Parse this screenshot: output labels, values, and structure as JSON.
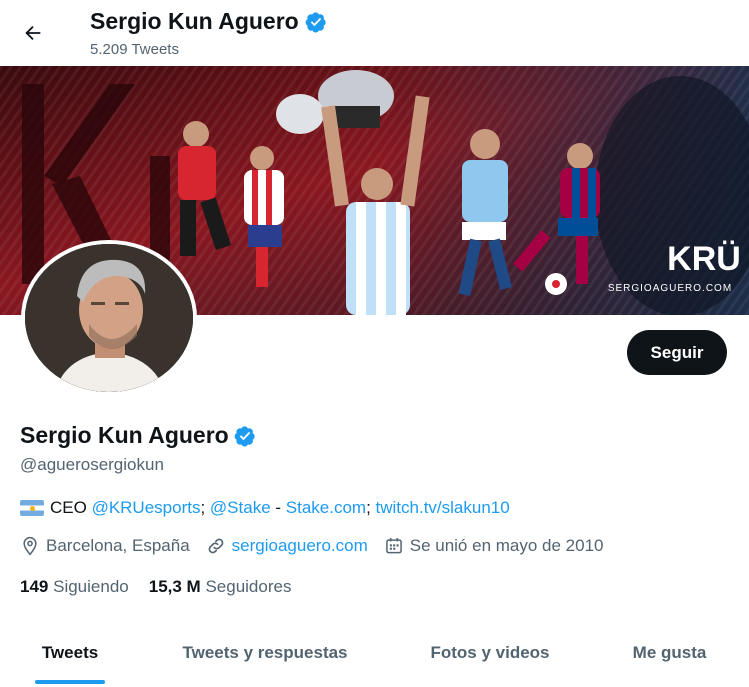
{
  "header": {
    "name": "Sergio Kun Aguero",
    "tweet_count": "5.209 Tweets"
  },
  "banner": {
    "brand_mark": "KRÜ",
    "site_text": "SERGIOAGUERO.COM"
  },
  "profile": {
    "name": "Sergio Kun Aguero",
    "handle": "@aguerosergiokun",
    "follow_label": "Seguir"
  },
  "bio": {
    "prefix": "CEO ",
    "mention1": "@KRUesports",
    "sep1": "; ",
    "mention2": "@Stake",
    "sep2": " - ",
    "link1": "Stake.com",
    "sep3": "; ",
    "link2": "twitch.tv/slakun10"
  },
  "meta": {
    "location": "Barcelona, España",
    "website": "sergioaguero.com",
    "joined": "Se unió en mayo de 2010"
  },
  "stats": {
    "following_count": "149",
    "following_label": "Siguiendo",
    "followers_count": "15,3 M",
    "followers_label": "Seguidores"
  },
  "tabs": [
    {
      "label": "Tweets",
      "active": true
    },
    {
      "label": "Tweets y respuestas",
      "active": false
    },
    {
      "label": "Fotos y videos",
      "active": false
    },
    {
      "label": "Me gusta",
      "active": false
    }
  ],
  "colors": {
    "accent": "#1d9bf0",
    "text": "#0f1419",
    "secondary": "#536471",
    "button": "#0f1419"
  },
  "icons": [
    "back-arrow-icon",
    "verified-badge-icon",
    "argentina-flag-icon",
    "location-pin-icon",
    "link-icon",
    "calendar-icon"
  ]
}
